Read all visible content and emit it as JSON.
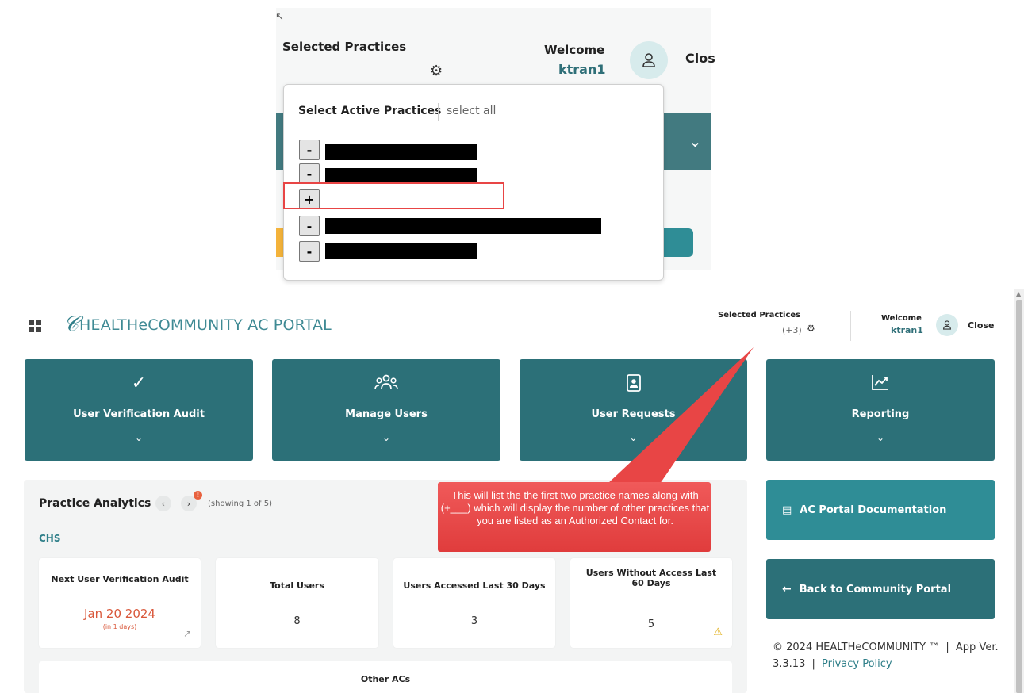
{
  "zoom": {
    "selected_practices_label": "Selected Practices",
    "welcome_label": "Welcome",
    "username": "ktran1",
    "close_label": "Clos",
    "popup": {
      "title": "Select Active Practices",
      "select_all": "select all",
      "items": [
        {
          "toggle": "-"
        },
        {
          "toggle": "-"
        },
        {
          "toggle": "+"
        },
        {
          "toggle": "-"
        },
        {
          "toggle": "-"
        }
      ]
    }
  },
  "header": {
    "app_title": "HEALTHeCOMMUNITY AC PORTAL",
    "selected_practices_label": "Selected Practices",
    "additional_count": "(+3)",
    "welcome_label": "Welcome",
    "username": "ktran1",
    "close_label": "Close"
  },
  "tiles": [
    {
      "label": "User Verification Audit",
      "icon": "check-icon"
    },
    {
      "label": "Manage Users",
      "icon": "users-icon"
    },
    {
      "label": "User Requests",
      "icon": "document-user-icon"
    },
    {
      "label": "Reporting",
      "icon": "trend-chart-icon"
    }
  ],
  "analytics": {
    "title": "Practice Analytics",
    "badge": "!",
    "showing": "(showing 1 of 5)",
    "practice_code": "CHS",
    "cards": [
      {
        "title": "Next User Verification Audit",
        "value": "Jan 20 2024",
        "sub": "(in 1 days)"
      },
      {
        "title": "Total Users",
        "value": "8"
      },
      {
        "title": "Users Accessed Last 30 Days",
        "value": "3"
      },
      {
        "title": "Users Without Access Last 60 Days",
        "value": "5"
      }
    ],
    "other_acs_title": "Other ACs"
  },
  "sidebar": {
    "documentation_label": "AC Portal Documentation",
    "back_label": "Back to Community Portal",
    "footer_copyright": "© 2024 HEALTHeCOMMUNITY ™",
    "footer_version": "App Ver. 3.3.13",
    "footer_privacy": "Privacy Policy"
  },
  "callout": {
    "text": "This will list the the first two practice names along with (+___) which will display the number of other practices that you are listed as an Authorized Contact for."
  },
  "colors": {
    "tile_teal": "#2c7078",
    "accent_teal": "#2f8d96",
    "callout_red": "#e84545",
    "alert_orange": "#e8613e"
  }
}
